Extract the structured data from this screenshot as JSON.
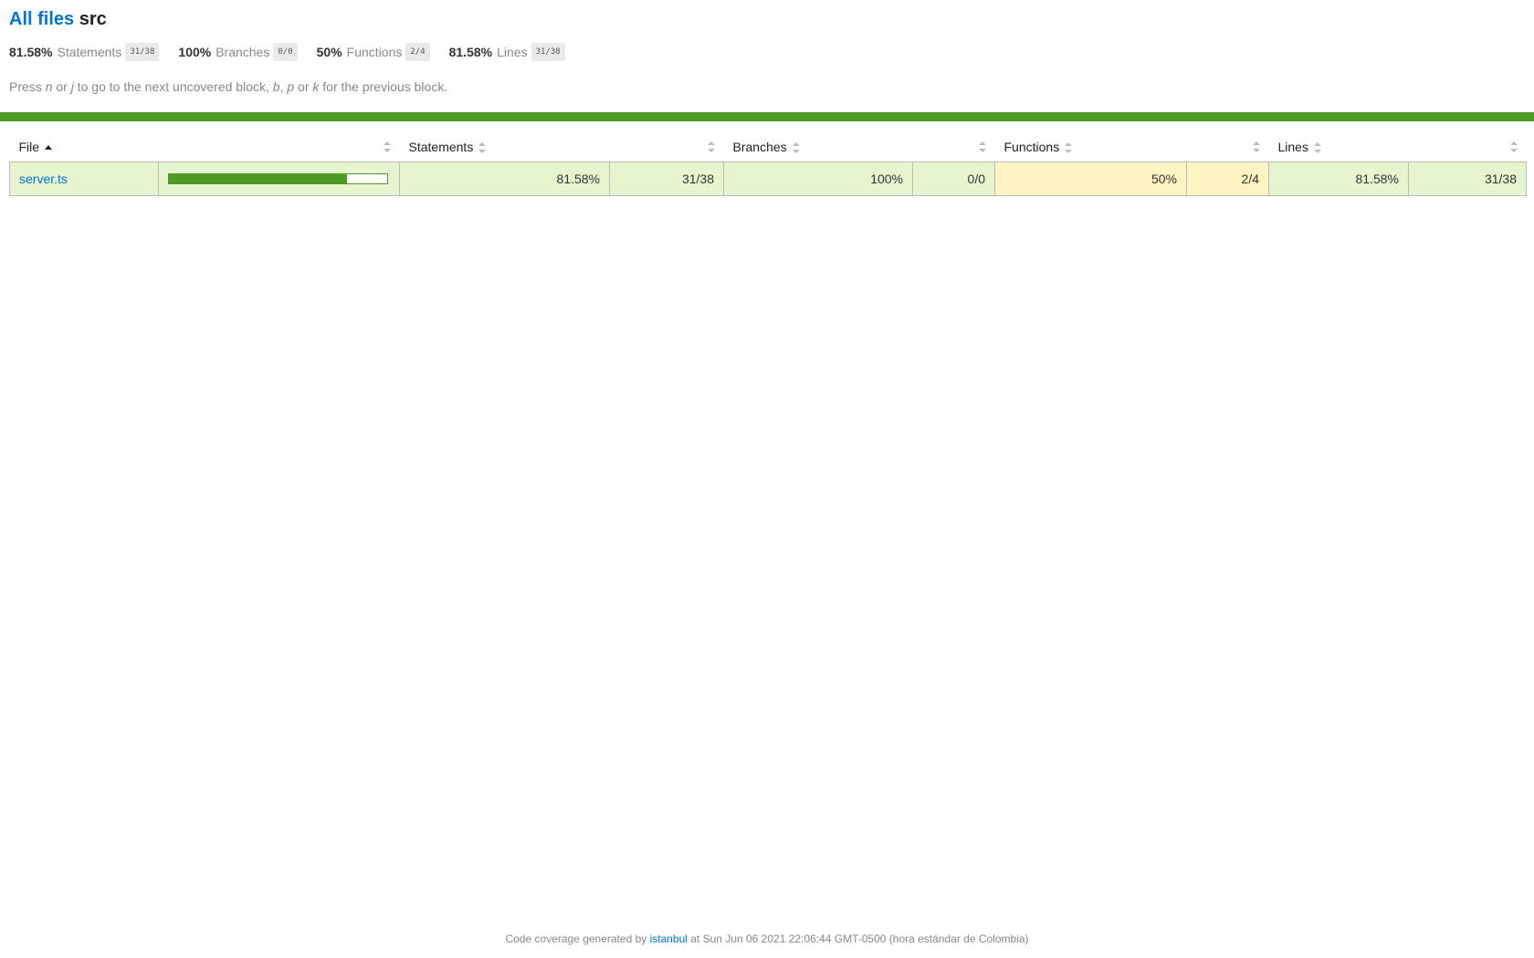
{
  "header": {
    "breadcrumb_link": "All files",
    "directory": "src"
  },
  "summary": [
    {
      "percent": "81.58%",
      "label": "Statements",
      "fraction": "31/38"
    },
    {
      "percent": "100%",
      "label": "Branches",
      "fraction": "0/0"
    },
    {
      "percent": "50%",
      "label": "Functions",
      "fraction": "2/4"
    },
    {
      "percent": "81.58%",
      "label": "Lines",
      "fraction": "31/38"
    }
  ],
  "hint": {
    "t1": "Press ",
    "k1": "n",
    "t2": " or ",
    "k2": "j",
    "t3": " to go to the next uncovered block, ",
    "k3": "b",
    "t4": ", ",
    "k4": "p",
    "t5": " or ",
    "k5": "k",
    "t6": " for the previous block."
  },
  "table": {
    "headers": {
      "file": "File",
      "statements": "Statements",
      "branches": "Branches",
      "functions": "Functions",
      "lines": "Lines"
    },
    "rows": [
      {
        "file": "server.ts",
        "coverage_fraction": 0.8158,
        "statements_pct": "81.58%",
        "statements_frac": "31/38",
        "branches_pct": "100%",
        "branches_frac": "0/0",
        "functions_pct": "50%",
        "functions_frac": "2/4",
        "lines_pct": "81.58%",
        "lines_frac": "31/38"
      }
    ]
  },
  "footer": {
    "prefix": "Code coverage generated by ",
    "link": "istanbul",
    "suffix": " at Sun Jun 06 2021 22:06:44 GMT-0500 (hora estándar de Colombia)"
  },
  "colors": {
    "high": "#e6f5d0",
    "medium": "#fff4c2",
    "status_high": "#4d9a25",
    "link": "#0074D9"
  }
}
